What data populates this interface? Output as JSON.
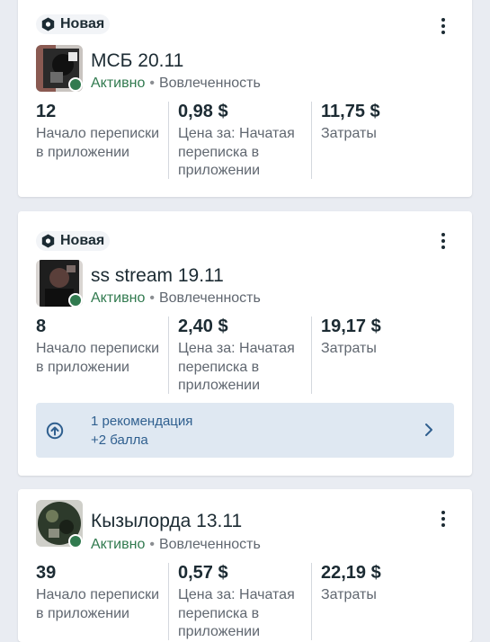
{
  "colors": {
    "active": "#317a4f",
    "reco_bg": "#dfe8f2",
    "reco_text": "#2f5f8f",
    "page_bg": "#e9ecf2"
  },
  "cards": [
    {
      "badge": "Новая",
      "name": "МСБ 20.11",
      "status_active": "Активно",
      "status_sep": "•",
      "status_type": "Вовлеченность",
      "metrics": [
        {
          "value": "12",
          "label": "Начало переписки в приложении"
        },
        {
          "value": "0,98 $",
          "label": "Цена за: Начатая переписка в приложении"
        },
        {
          "value": "11,75 $",
          "label": "Затраты"
        }
      ]
    },
    {
      "badge": "Новая",
      "name": "ss stream 19.11",
      "status_active": "Активно",
      "status_sep": "•",
      "status_type": "Вовлеченность",
      "metrics": [
        {
          "value": "8",
          "label": "Начало переписки в приложении"
        },
        {
          "value": "2,40 $",
          "label": "Цена за: Начатая переписка в приложении"
        },
        {
          "value": "19,17 $",
          "label": "Затраты"
        }
      ],
      "recommendation": {
        "line1": "1 рекомендация",
        "line2": "+2 балла"
      }
    },
    {
      "name": "Кызылорда 13.11",
      "status_active": "Активно",
      "status_sep": "•",
      "status_type": "Вовлеченность",
      "metrics": [
        {
          "value": "39",
          "label": "Начало переписки в приложении"
        },
        {
          "value": "0,57 $",
          "label": "Цена за: Начатая переписка в приложении"
        },
        {
          "value": "22,19 $",
          "label": "Затраты"
        }
      ]
    }
  ]
}
